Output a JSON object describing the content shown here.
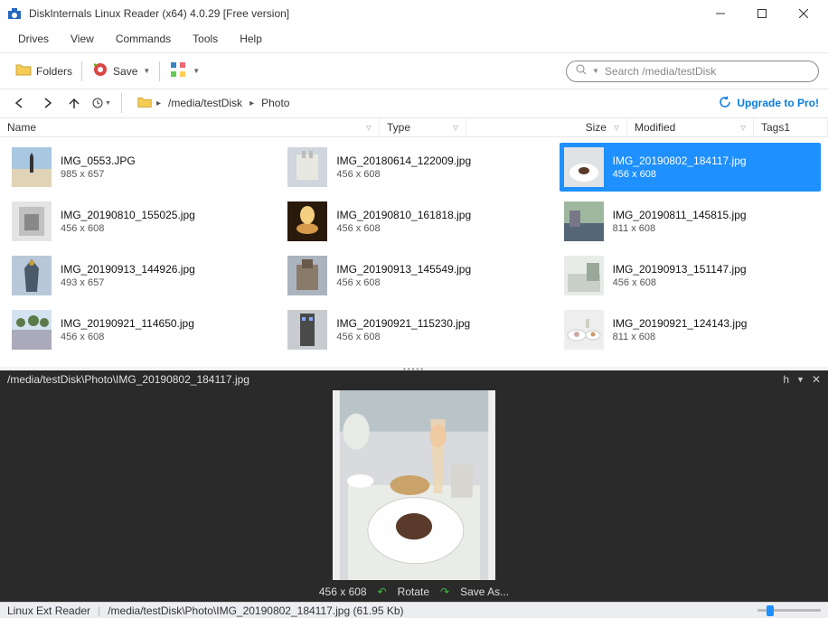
{
  "titlebar": {
    "title": "DiskInternals Linux Reader (x64) 4.0.29 [Free version]"
  },
  "menu": {
    "drives": "Drives",
    "view": "View",
    "commands": "Commands",
    "tools": "Tools",
    "help": "Help"
  },
  "toolbar": {
    "folders": "Folders",
    "save": "Save"
  },
  "search": {
    "placeholder": "Search /media/testDisk"
  },
  "breadcrumb": {
    "seg1": "/media/testDisk",
    "seg2": "Photo"
  },
  "upgrade": "Upgrade to Pro!",
  "columns": {
    "name": "Name",
    "type": "Type",
    "size": "Size",
    "modified": "Modified",
    "tags": "Tags1"
  },
  "files": [
    {
      "name": "IMG_0553.JPG",
      "dims": "985 x 657"
    },
    {
      "name": "IMG_20180614_122009.jpg",
      "dims": "456 x 608"
    },
    {
      "name": "IMG_20190802_184117.jpg",
      "dims": "456 x 608",
      "selected": true
    },
    {
      "name": "IMG_20190810_155025.jpg",
      "dims": "456 x 608"
    },
    {
      "name": "IMG_20190810_161818.jpg",
      "dims": "456 x 608"
    },
    {
      "name": "IMG_20190811_145815.jpg",
      "dims": "811 x 608"
    },
    {
      "name": "IMG_20190913_144926.jpg",
      "dims": "493 x 657"
    },
    {
      "name": "IMG_20190913_145549.jpg",
      "dims": "456 x 608"
    },
    {
      "name": "IMG_20190913_151147.jpg",
      "dims": "456 x 608"
    },
    {
      "name": "IMG_20190921_114650.jpg",
      "dims": "456 x 608"
    },
    {
      "name": "IMG_20190921_115230.jpg",
      "dims": "456 x 608"
    },
    {
      "name": "IMG_20190921_124143.jpg",
      "dims": "811 x 608"
    }
  ],
  "preview": {
    "path": "/media/testDisk\\Photo\\IMG_20190802_184117.jpg",
    "dims": "456 x 608",
    "rotate": "Rotate",
    "saveas": "Save As...",
    "corner": "h"
  },
  "statusbar": {
    "reader": "Linux Ext Reader",
    "info": "/media/testDisk\\Photo\\IMG_20190802_184117.jpg (61.95 Kb)"
  }
}
